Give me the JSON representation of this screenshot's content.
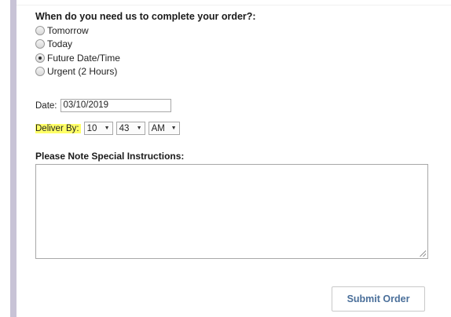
{
  "form": {
    "question": "When do you need us to complete your order?:",
    "options": [
      {
        "label": "Tomorrow",
        "checked": false
      },
      {
        "label": "Today",
        "checked": false
      },
      {
        "label": "Future Date/Time",
        "checked": true
      },
      {
        "label": "Urgent (2 Hours)",
        "checked": false
      }
    ],
    "date_label": "Date:",
    "date_value": "03/10/2019",
    "deliver_label": "Deliver By:",
    "hour": "10",
    "minute": "43",
    "ampm": "AM",
    "instructions_label": "Please Note Special Instructions:",
    "instructions_value": "",
    "submit_label": "Submit Order"
  },
  "colors": {
    "highlight": "#ffff66",
    "sidebar_stripe": "#c8c3d6",
    "submit_text": "#4a6f9a"
  },
  "icons": {
    "dropdown": "triangle-down-icon",
    "radio": "radio-button-icon",
    "resize": "resize-grip-icon"
  }
}
